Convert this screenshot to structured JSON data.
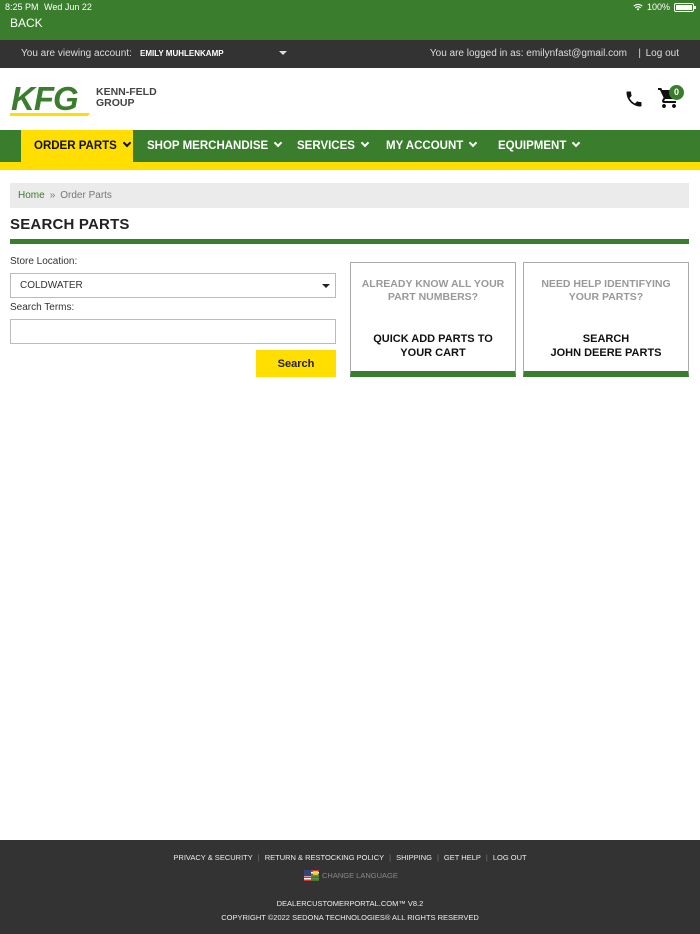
{
  "status": {
    "time": "8:25 PM",
    "date": "Wed Jun 22",
    "battery": "100%"
  },
  "back_label": "BACK",
  "account": {
    "viewing_label": "You are viewing account:",
    "name": "EMILY MUHLENKAMP",
    "logged_in_text": "You are logged in as: emilynfast@gmail.com",
    "separator": "|",
    "logout": "Log out"
  },
  "brand": {
    "logo_letters": "KFG",
    "line1": "KENN-FELD",
    "line2": "GROUP",
    "green": "#3a7d2c",
    "yellow": "#ffde00"
  },
  "cart": {
    "count": "0"
  },
  "nav": {
    "items": [
      {
        "label": "ORDER PARTS"
      },
      {
        "label": "SHOP MERCHANDISE"
      },
      {
        "label": "SERVICES"
      },
      {
        "label": "MY ACCOUNT"
      },
      {
        "label": "EQUIPMENT"
      }
    ]
  },
  "breadcrumb": {
    "home": "Home",
    "sep": "»",
    "current": "Order Parts"
  },
  "page_title": "SEARCH PARTS",
  "form": {
    "store_label": "Store Location:",
    "store_value": "COLDWATER",
    "terms_label": "Search Terms:",
    "terms_value": "",
    "search_button": "Search"
  },
  "cards": [
    {
      "question": "ALREADY KNOW ALL YOUR PART NUMBERS?",
      "action": "QUICK ADD PARTS TO YOUR CART"
    },
    {
      "question": "NEED HELP IDENTIFYING YOUR PARTS?",
      "action_line1": "SEARCH",
      "action_line2": "JOHN DEERE PARTS"
    }
  ],
  "footer": {
    "links": [
      "PRIVACY & SECURITY",
      "RETURN & RESTOCKING POLICY",
      "SHIPPING",
      "GET HELP",
      "LOG OUT"
    ],
    "sep": "|",
    "language": "CHANGE LANGUAGE",
    "site": "DEALERCUSTOMERPORTAL.COM™ V8.2",
    "copyright": "COPYRIGHT ©2022 SEDONA TECHNOLOGIES® ALL RIGHTS RESERVED"
  }
}
